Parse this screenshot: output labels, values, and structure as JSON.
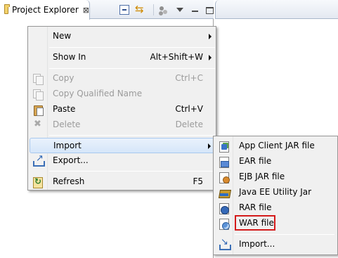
{
  "project_explorer": {
    "tab_title": "Project Explorer",
    "close_glyph": "⊠"
  },
  "context_menu": {
    "items": [
      {
        "label": "New",
        "shortcut": "",
        "submenu": true,
        "enabled": true
      },
      {
        "label": "Show In",
        "shortcut": "Alt+Shift+W",
        "submenu": true,
        "enabled": true
      },
      {
        "label": "Copy",
        "shortcut": "Ctrl+C",
        "submenu": false,
        "enabled": false
      },
      {
        "label": "Copy Qualified Name",
        "shortcut": "",
        "submenu": false,
        "enabled": false
      },
      {
        "label": "Paste",
        "shortcut": "Ctrl+V",
        "submenu": false,
        "enabled": true
      },
      {
        "label": "Delete",
        "shortcut": "Delete",
        "submenu": false,
        "enabled": false
      },
      {
        "label": "Import",
        "shortcut": "",
        "submenu": true,
        "enabled": true,
        "active": true
      },
      {
        "label": "Export...",
        "shortcut": "",
        "submenu": false,
        "enabled": true
      },
      {
        "label": "Refresh",
        "shortcut": "F5",
        "submenu": false,
        "enabled": true
      }
    ]
  },
  "import_submenu": {
    "items": [
      {
        "label": "App Client JAR file",
        "icon": "app-client-jar-icon"
      },
      {
        "label": "EAR file",
        "icon": "ear-file-icon"
      },
      {
        "label": "EJB JAR file",
        "icon": "ejb-jar-icon"
      },
      {
        "label": "Java EE Utility Jar",
        "icon": "utility-jar-icon"
      },
      {
        "label": "RAR file",
        "icon": "rar-file-icon"
      },
      {
        "label": "WAR file",
        "icon": "war-file-icon",
        "highlighted": true
      },
      {
        "label": "Import...",
        "icon": "import-icon"
      }
    ],
    "highlight_color": "#d41a1a"
  },
  "colors": {
    "menu_background": "#f0f0f0",
    "active_item": "#d6e6f9",
    "disabled_text": "#9b9b9b"
  }
}
